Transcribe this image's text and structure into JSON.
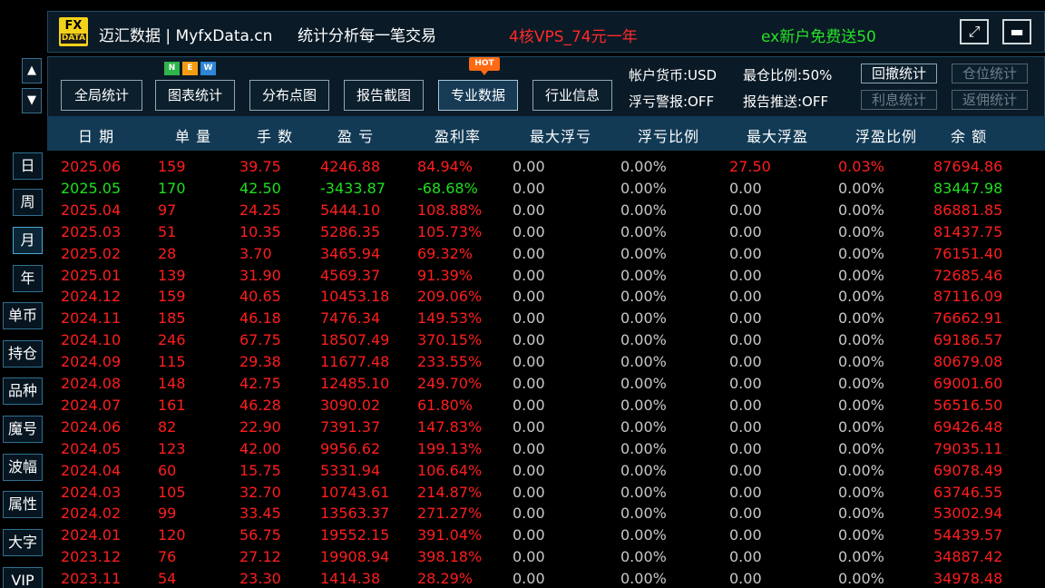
{
  "header": {
    "logo_top": "FX",
    "logo_bottom": "DATA",
    "brand": "迈汇数据 | MyfxData.cn",
    "slogan": "统计分析每一笔交易",
    "promo_vps": "4核VPS_74元一年",
    "promo_ex": "ex新户免费送50",
    "restore_glyph": "⤢",
    "minimize_glyph": "▬"
  },
  "scroll": {
    "up": "▲",
    "down": "▼"
  },
  "sidebar": {
    "items": [
      {
        "label": "日",
        "active": false
      },
      {
        "label": "周",
        "active": false
      },
      {
        "label": "月",
        "active": true
      },
      {
        "label": "年",
        "active": false
      },
      {
        "label": "单币",
        "active": false
      },
      {
        "label": "持仓",
        "active": false
      },
      {
        "label": "品种",
        "active": false
      },
      {
        "label": "魔号",
        "active": false
      },
      {
        "label": "波幅",
        "active": false
      },
      {
        "label": "属性",
        "active": false
      },
      {
        "label": "大字",
        "active": false
      },
      {
        "label": "VIP",
        "active": false
      }
    ]
  },
  "toolbar": {
    "buttons": [
      {
        "label": "全局统计"
      },
      {
        "label": "图表统计"
      },
      {
        "label": "分布点图"
      },
      {
        "label": "报告截图"
      },
      {
        "label": "专业数据"
      },
      {
        "label": "行业信息"
      }
    ],
    "new_badge": [
      "N",
      "E",
      "W"
    ],
    "hot_badge": "HOT",
    "account_currency": "帐户货币:USD",
    "max_ratio": "最仓比例:50%",
    "float_loss_alert": "浮亏警报:OFF",
    "report_push": "报告推送:OFF",
    "mini_buttons": [
      {
        "label": "回撤统计",
        "enabled": true
      },
      {
        "label": "仓位统计",
        "enabled": false
      },
      {
        "label": "利息统计",
        "enabled": false
      },
      {
        "label": "返佣统计",
        "enabled": false
      }
    ]
  },
  "colors": {
    "profit": "#ff1e1e",
    "loss": "#1ee01e",
    "neutral": "#c9c9c9",
    "header_bg": "#123a55"
  },
  "table": {
    "columns": [
      "日 期",
      "单 量",
      "手 数",
      "盈 亏",
      "盈利率",
      "最大浮亏",
      "浮亏比例",
      "最大浮盈",
      "浮盈比例",
      "余 额"
    ],
    "rows": [
      {
        "tone": "red",
        "cells": [
          "2025.06",
          "159",
          "39.75",
          "4246.88",
          "84.94%",
          "0.00",
          "0.00%",
          "27.50",
          "0.03%",
          "87694.86"
        ]
      },
      {
        "tone": "green",
        "cells": [
          "2025.05",
          "170",
          "42.50",
          "-3433.87",
          "-68.68%",
          "0.00",
          "0.00%",
          "0.00",
          "0.00%",
          "83447.98"
        ]
      },
      {
        "tone": "red",
        "cells": [
          "2025.04",
          "97",
          "24.25",
          "5444.10",
          "108.88%",
          "0.00",
          "0.00%",
          "0.00",
          "0.00%",
          "86881.85"
        ]
      },
      {
        "tone": "red",
        "cells": [
          "2025.03",
          "51",
          "10.35",
          "5286.35",
          "105.73%",
          "0.00",
          "0.00%",
          "0.00",
          "0.00%",
          "81437.75"
        ]
      },
      {
        "tone": "red",
        "cells": [
          "2025.02",
          "28",
          "3.70",
          "3465.94",
          "69.32%",
          "0.00",
          "0.00%",
          "0.00",
          "0.00%",
          "76151.40"
        ]
      },
      {
        "tone": "red",
        "cells": [
          "2025.01",
          "139",
          "31.90",
          "4569.37",
          "91.39%",
          "0.00",
          "0.00%",
          "0.00",
          "0.00%",
          "72685.46"
        ]
      },
      {
        "tone": "red",
        "cells": [
          "2024.12",
          "159",
          "40.65",
          "10453.18",
          "209.06%",
          "0.00",
          "0.00%",
          "0.00",
          "0.00%",
          "87116.09"
        ]
      },
      {
        "tone": "red",
        "cells": [
          "2024.11",
          "185",
          "46.18",
          "7476.34",
          "149.53%",
          "0.00",
          "0.00%",
          "0.00",
          "0.00%",
          "76662.91"
        ]
      },
      {
        "tone": "red",
        "cells": [
          "2024.10",
          "246",
          "67.75",
          "18507.49",
          "370.15%",
          "0.00",
          "0.00%",
          "0.00",
          "0.00%",
          "69186.57"
        ]
      },
      {
        "tone": "red",
        "cells": [
          "2024.09",
          "115",
          "29.38",
          "11677.48",
          "233.55%",
          "0.00",
          "0.00%",
          "0.00",
          "0.00%",
          "80679.08"
        ]
      },
      {
        "tone": "red",
        "cells": [
          "2024.08",
          "148",
          "42.75",
          "12485.10",
          "249.70%",
          "0.00",
          "0.00%",
          "0.00",
          "0.00%",
          "69001.60"
        ]
      },
      {
        "tone": "red",
        "cells": [
          "2024.07",
          "161",
          "46.28",
          "3090.02",
          "61.80%",
          "0.00",
          "0.00%",
          "0.00",
          "0.00%",
          "56516.50"
        ]
      },
      {
        "tone": "red",
        "cells": [
          "2024.06",
          "82",
          "22.90",
          "7391.37",
          "147.83%",
          "0.00",
          "0.00%",
          "0.00",
          "0.00%",
          "69426.48"
        ]
      },
      {
        "tone": "red",
        "cells": [
          "2024.05",
          "123",
          "42.00",
          "9956.62",
          "199.13%",
          "0.00",
          "0.00%",
          "0.00",
          "0.00%",
          "79035.11"
        ]
      },
      {
        "tone": "red",
        "cells": [
          "2024.04",
          "60",
          "15.75",
          "5331.94",
          "106.64%",
          "0.00",
          "0.00%",
          "0.00",
          "0.00%",
          "69078.49"
        ]
      },
      {
        "tone": "red",
        "cells": [
          "2024.03",
          "105",
          "32.70",
          "10743.61",
          "214.87%",
          "0.00",
          "0.00%",
          "0.00",
          "0.00%",
          "63746.55"
        ]
      },
      {
        "tone": "red",
        "cells": [
          "2024.02",
          "99",
          "33.45",
          "13563.37",
          "271.27%",
          "0.00",
          "0.00%",
          "0.00",
          "0.00%",
          "53002.94"
        ]
      },
      {
        "tone": "red",
        "cells": [
          "2024.01",
          "120",
          "56.75",
          "19552.15",
          "391.04%",
          "0.00",
          "0.00%",
          "0.00",
          "0.00%",
          "54439.57"
        ]
      },
      {
        "tone": "red",
        "cells": [
          "2023.12",
          "76",
          "27.12",
          "19908.94",
          "398.18%",
          "0.00",
          "0.00%",
          "0.00",
          "0.00%",
          "34887.42"
        ]
      },
      {
        "tone": "red",
        "cells": [
          "2023.11",
          "54",
          "23.30",
          "1414.38",
          "28.29%",
          "0.00",
          "0.00%",
          "0.00",
          "0.00%",
          "34978.48"
        ]
      }
    ]
  }
}
